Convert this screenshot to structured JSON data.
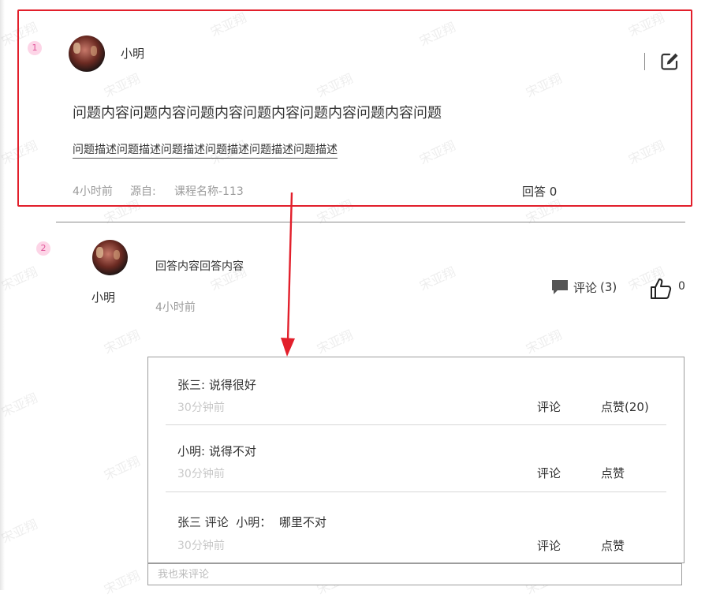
{
  "watermark": "宋亚翔",
  "question": {
    "marker": "1",
    "author": "小明",
    "title": "问题内容问题内容问题内容问题内容问题内容问题内容问题",
    "description": "问题描述问题描述问题描述问题描述问题描述问题描述",
    "time": "4小时前",
    "source_label": "源自:",
    "source_value": "课程名称-113",
    "answers": "回答 0",
    "edit_icon": "edit-square-icon"
  },
  "answer": {
    "marker": "2",
    "author": "小明",
    "content": "回答内容回答内容",
    "time": "4小时前",
    "comment_label": "评论",
    "comment_count": "(3)",
    "like_count": "0",
    "comment_icon": "chat-bubble-icon",
    "like_icon": "thumbs-up-icon"
  },
  "comments": [
    {
      "text": "张三:  说得很好",
      "time": "30分钟前",
      "comment": "评论",
      "like": "点赞(20)"
    },
    {
      "text": "小明:  说得不对",
      "time": "30分钟前",
      "comment": "评论",
      "like": "点赞"
    },
    {
      "text": "张三 评论  小明：  哪里不对",
      "time": "30分钟前",
      "comment": "评论",
      "like": "点赞"
    }
  ],
  "comment_input": {
    "placeholder": "我也来评论"
  },
  "colors": {
    "highlight_red": "#e21f2b",
    "marker_pink": "#fdd5e7",
    "marker_text": "#e0569a"
  }
}
